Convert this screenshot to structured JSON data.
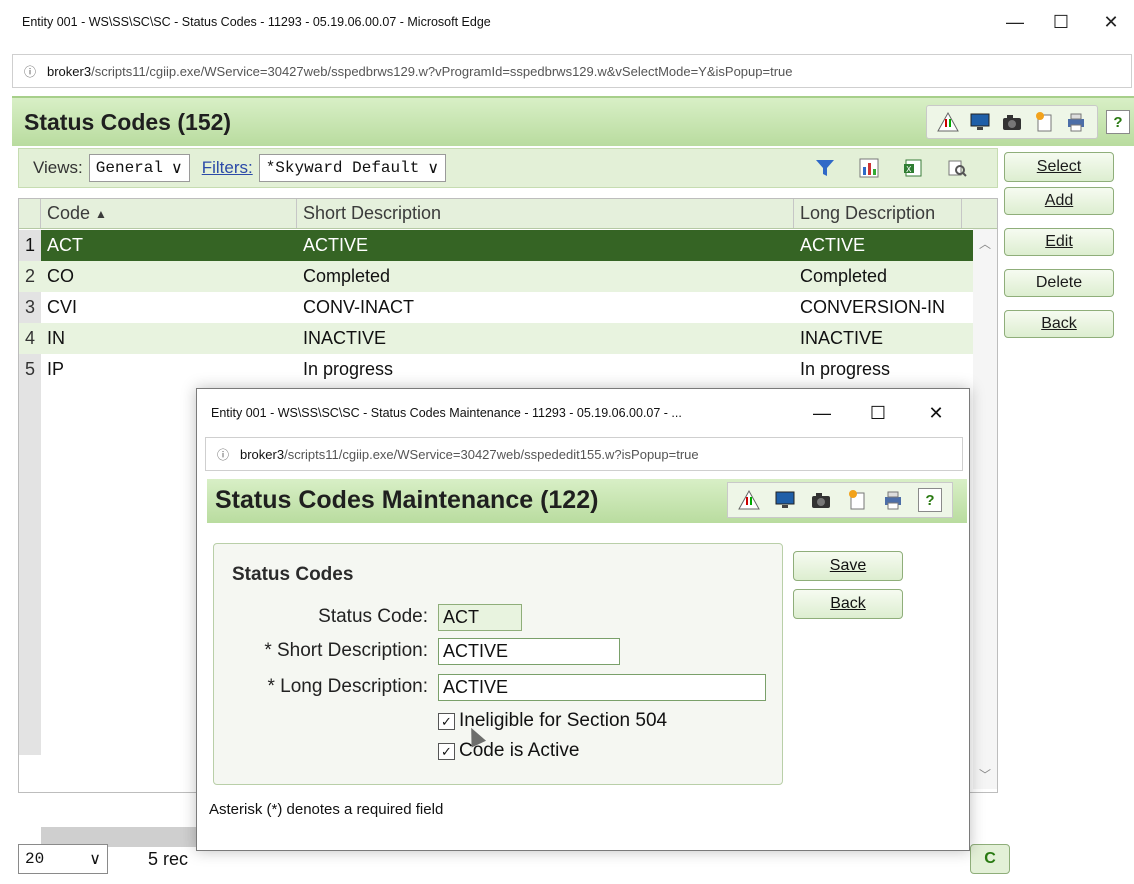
{
  "window": {
    "title": "Entity 001 - WS\\SS\\SC\\SC - Status Codes - 11293 - 05.19.06.00.07 - Microsoft Edge",
    "address_host": "broker3",
    "address_path": "/scripts11/cgiip.exe/WService=30427web/sspedbrws129.w?vProgramId=sspedbrws129.w&vSelectMode=Y&isPopup=true"
  },
  "page": {
    "title": "Status Codes (152)",
    "views_label": "Views:",
    "views_value": "General",
    "filters_label": "Filters:",
    "filters_value": "*Skyward Default",
    "side_buttons": [
      "Select",
      "Add",
      "Edit",
      "Delete",
      "Back"
    ]
  },
  "grid": {
    "columns": [
      "Code",
      "Short Description",
      "Long Description"
    ],
    "sort_indicator": "▲",
    "rows": [
      {
        "num": "1",
        "code": "ACT",
        "short": "ACTIVE",
        "long": "ACTIVE",
        "selected": true
      },
      {
        "num": "2",
        "code": "CO",
        "short": "Completed",
        "long": "Completed"
      },
      {
        "num": "3",
        "code": "CVI",
        "short": "CONV-INACT",
        "long": "CONVERSION-IN"
      },
      {
        "num": "4",
        "code": "IN",
        "short": "INACTIVE",
        "long": "INACTIVE"
      },
      {
        "num": "5",
        "code": "IP",
        "short": "In progress",
        "long": "In progress"
      }
    ],
    "page_size": "20",
    "records_text": "5 rec",
    "corner_button": "C"
  },
  "popup": {
    "title": "Entity 001 - WS\\SS\\SC\\SC - Status Codes Maintenance - 11293 - 05.19.06.00.07 - ...",
    "address_host": "broker3",
    "address_path": "/scripts11/cgiip.exe/WService=30427web/sspededit155.w?isPopup=true",
    "header_title": "Status Codes Maintenance (122)",
    "section_title": "Status Codes",
    "status_code_label": "Status Code:",
    "status_code_value": "ACT",
    "short_desc_label": "* Short Description:",
    "short_desc_value": "ACTIVE",
    "long_desc_label": "* Long Description:",
    "long_desc_value": "ACTIVE",
    "check_ineligible": "Ineligible for Section 504",
    "check_active": "Code is Active",
    "save_label": "Save",
    "back_label": "Back",
    "note": "Asterisk (*) denotes a required field"
  },
  "colors": {
    "accent_green": "#356424",
    "header_green": "#b9dc9f"
  }
}
